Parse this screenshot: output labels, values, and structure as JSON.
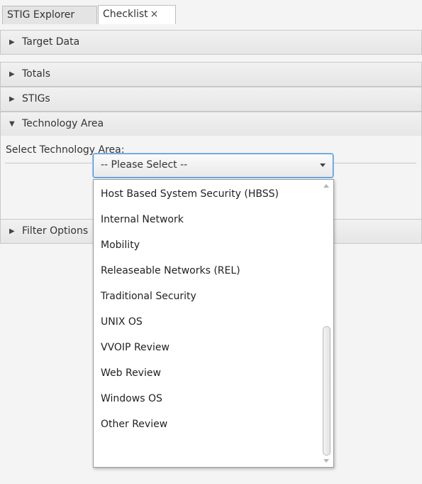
{
  "tabs": [
    {
      "label": "STIG Explorer"
    },
    {
      "label": "Checklist",
      "close_icon": "×"
    }
  ],
  "accordion": {
    "target_data": {
      "label": "Target Data",
      "arrow": "▶"
    },
    "totals": {
      "label": "Totals",
      "arrow": "▶"
    },
    "stigs": {
      "label": "STIGs",
      "arrow": "▶"
    },
    "technology_area": {
      "label": "Technology Area",
      "arrow": "▼"
    },
    "filter_options": {
      "label": "Filter Options",
      "arrow": "▶"
    }
  },
  "technology_area": {
    "prompt": "Select Technology Area:",
    "combo_value": "-- Please Select --",
    "options": [
      "Host Based System Security (HBSS)",
      "Internal Network",
      "Mobility",
      "Releaseable Networks (REL)",
      "Traditional Security",
      "UNIX OS",
      "VVOIP Review",
      "Web Review",
      "Windows OS",
      "Other Review"
    ]
  },
  "icons": {
    "collapsed": "triangle-right-icon",
    "expanded": "triangle-down-icon",
    "combo_caret": "chevron-down-icon",
    "close": "close-icon"
  },
  "colors": {
    "focus_border": "#3a8fd6",
    "panel_bg": "#f4f4f4",
    "header_bg": "#e6e6e6"
  }
}
